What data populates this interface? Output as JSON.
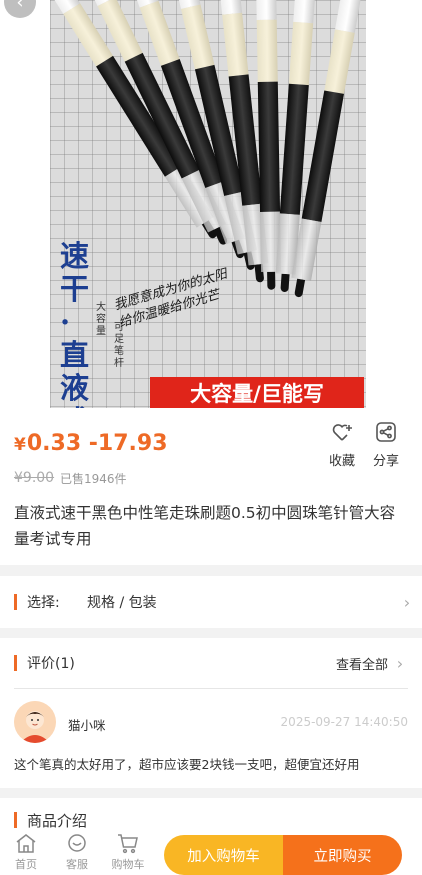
{
  "hero": {
    "vertical_title": "速干·直液式",
    "sub_text_1": "大容量",
    "sub_text_2": "可足笔杆",
    "script_line_1": "我愿意成为你的太阳",
    "script_line_2": "给你温暖给你光芒",
    "banner": "大容量/巨能写"
  },
  "product": {
    "currency": "¥",
    "price_range": "0.33 -17.93",
    "original_price": "¥9.00",
    "sold": "已售1946件",
    "title": "直液式速干黑色中性笔走珠刷题0.5初中圆珠笔针管大容量考试专用"
  },
  "actions": {
    "favorite_label": "收藏",
    "share_label": "分享"
  },
  "selection": {
    "label": "选择:",
    "value": "规格 / 包装"
  },
  "reviews": {
    "heading": "评价(1)",
    "see_all": "查看全部",
    "items": [
      {
        "nickname": "猫小咪",
        "date": "2025-09-27 14:40:50",
        "text": "这个笔真的太好用了，超市应该要2块钱一支吧，超便宜还好用"
      }
    ]
  },
  "intro": {
    "heading": "商品介绍"
  },
  "bottom_nav": {
    "home": "首页",
    "service": "客服",
    "cart": "购物车",
    "add_to_cart": "加入购物车",
    "buy_now": "立即购买"
  },
  "colors": {
    "accent": "#ee6a26",
    "cart_button": "#f9b624",
    "buy_button": "#f5711b",
    "banner": "#e0251a"
  }
}
